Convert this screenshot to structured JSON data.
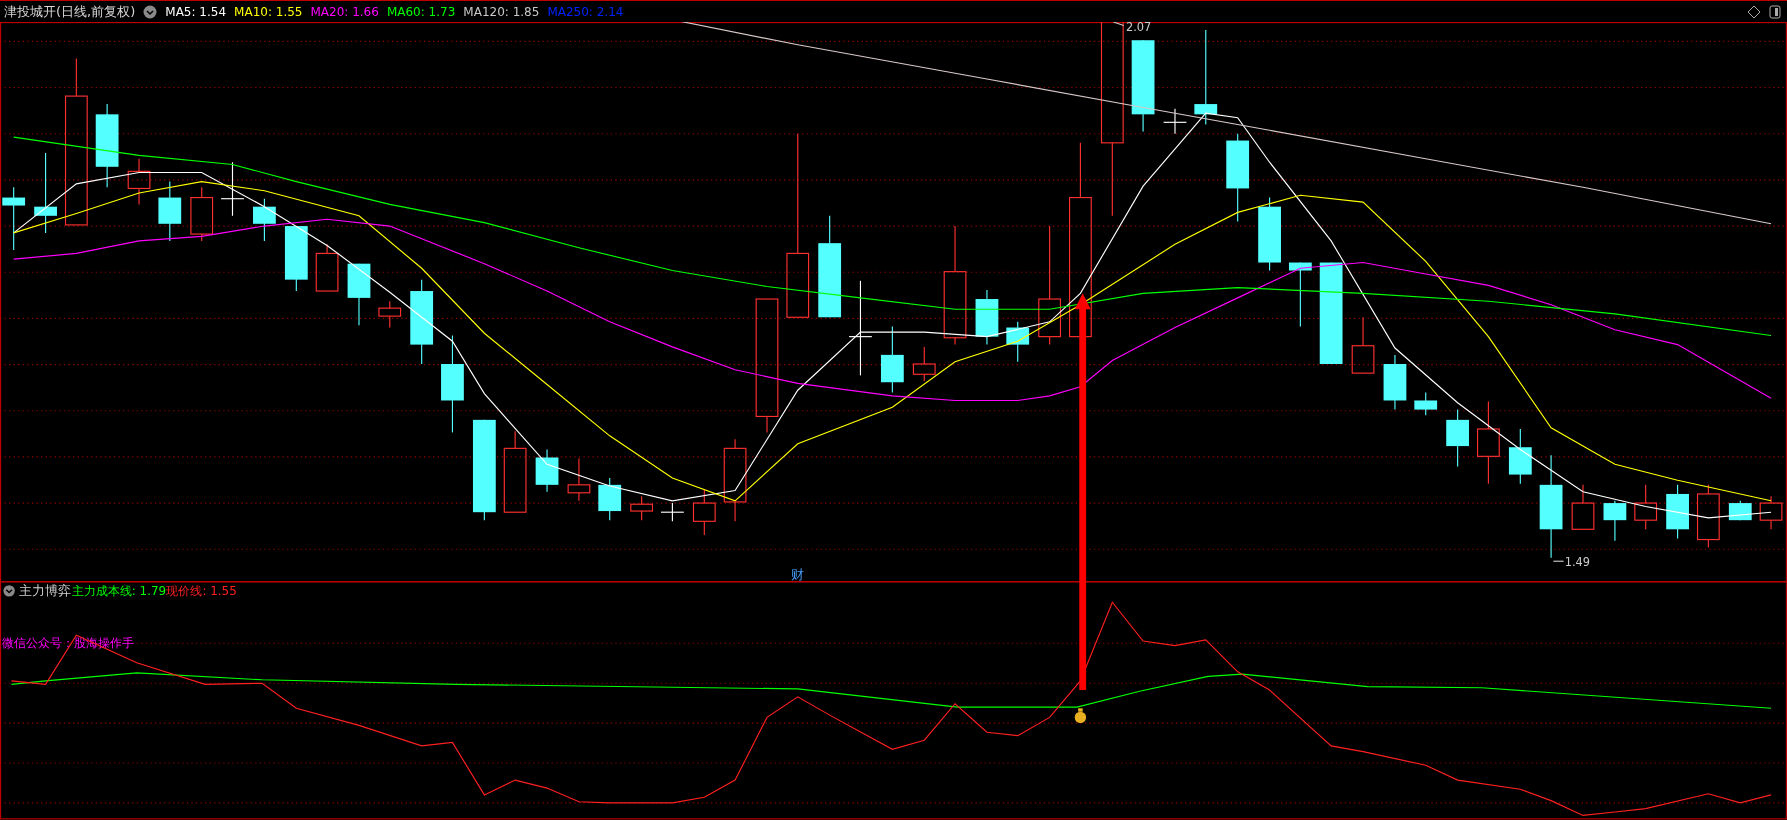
{
  "header": {
    "title": "津投城开(日线,前复权)",
    "ma_items": [
      {
        "text": "MA5: 1.54",
        "color": "#ffffff"
      },
      {
        "text": "MA10: 1.55",
        "color": "#ffff00"
      },
      {
        "text": "MA20: 1.66",
        "color": "#ff00ff"
      },
      {
        "text": "MA60: 1.73",
        "color": "#00ff00"
      },
      {
        "text": "MA120: 1.85",
        "color": "#c8c8c8"
      },
      {
        "text": "MA250: 2.14",
        "color": "#0022ff"
      }
    ]
  },
  "main_chart": {
    "high_label": "2.07",
    "low_label": "1.49",
    "marker_label": "财"
  },
  "indicator": {
    "title": "主力博弈",
    "items": [
      {
        "text": "主力成本线: 1.79",
        "color": "#00ff00"
      },
      {
        "text": "现价线: 1.55",
        "color": "#ff2020"
      }
    ],
    "note": "微信公众号：股海操作手"
  }
}
